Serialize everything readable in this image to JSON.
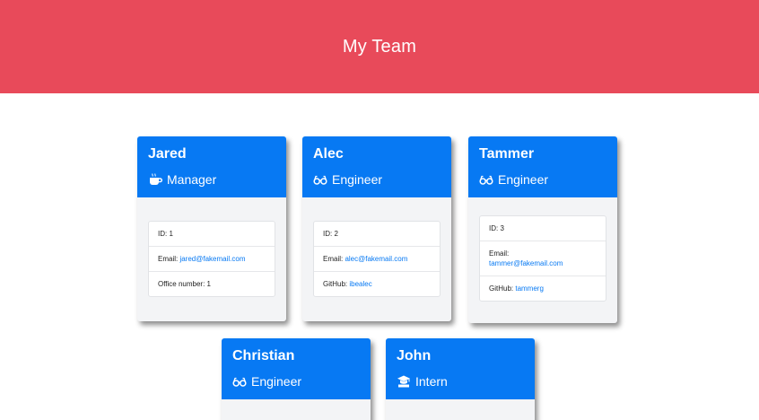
{
  "header": {
    "title": "My Team"
  },
  "cards": [
    {
      "name": "Jared",
      "role": "Manager",
      "role_icon": "coffee-icon",
      "id": "ID: 1",
      "email_label": "Email: ",
      "email": "jared@fakemail.com",
      "extra_label": "Office number: 1",
      "extra_value": ""
    },
    {
      "name": "Alec",
      "role": "Engineer",
      "role_icon": "glasses-icon",
      "id": "ID: 2",
      "email_label": "Email: ",
      "email": "alec@fakemail.com",
      "extra_label": "GitHub: ",
      "extra_value": "ibealec"
    },
    {
      "name": "Tammer",
      "role": "Engineer",
      "role_icon": "glasses-icon",
      "id": "ID: 3",
      "email_label": "Email: ",
      "email": "tammer@fakemail.com",
      "extra_label": "GitHub: ",
      "extra_value": "tammerg"
    },
    {
      "name": "Christian",
      "role": "Engineer",
      "role_icon": "glasses-icon"
    },
    {
      "name": "John",
      "role": "Intern",
      "role_icon": "graduate-icon"
    }
  ],
  "colors": {
    "header": "#e84a5a",
    "card_header": "#0779f3",
    "link": "#0779f3"
  }
}
